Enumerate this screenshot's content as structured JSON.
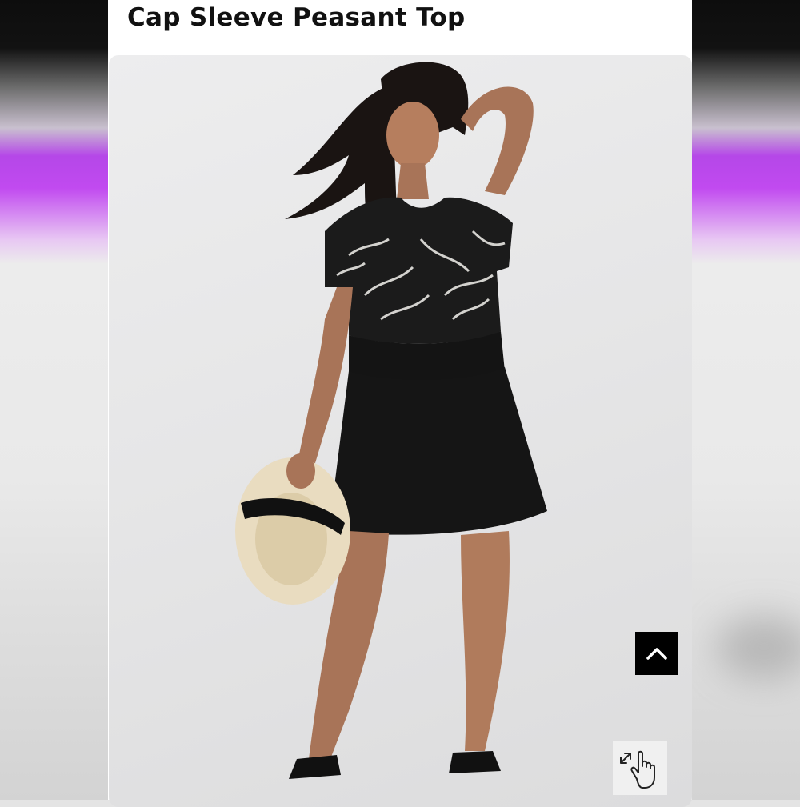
{
  "product": {
    "title": "Cap Sleeve Peasant Top"
  },
  "photo": {
    "alt": "Cap Sleeve Peasant Top"
  },
  "controls": {
    "back_to_top_icon": "chevron-up-icon",
    "zoom_icon": "hand-pointer-expand-icon"
  },
  "colors": {
    "accent_side": "#c14af0",
    "button_bg": "#000000"
  }
}
